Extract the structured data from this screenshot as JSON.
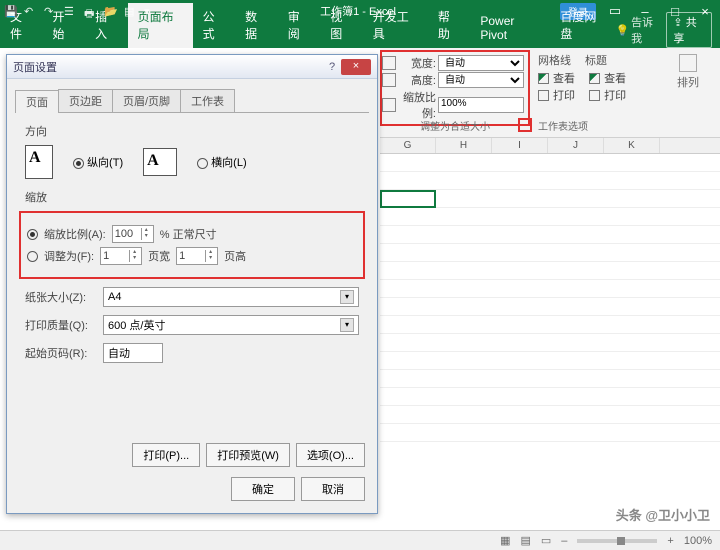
{
  "app": {
    "title": "工作簿1 - Excel",
    "login": "登录",
    "share": "共享",
    "tell": "告诉我"
  },
  "qat": [
    "save",
    "undo",
    "redo",
    "touch",
    "print",
    "open",
    "new",
    "more"
  ],
  "tabs": [
    "文件",
    "开始",
    "插入",
    "页面布局",
    "公式",
    "数据",
    "审阅",
    "视图",
    "开发工具",
    "帮助",
    "Power Pivot",
    "百度网盘"
  ],
  "activeTab": 3,
  "ribbon": {
    "scale": {
      "widthLabel": "宽度:",
      "widthVal": "自动",
      "heightLabel": "高度:",
      "heightVal": "自动",
      "scaleLabel": "缩放比例:",
      "scaleVal": "100%",
      "group": "调整为合适大小"
    },
    "opts": {
      "h1": "网格线",
      "h2": "标题",
      "view": "查看",
      "print": "打印",
      "group": "工作表选项"
    },
    "arrange": "排列"
  },
  "cols": [
    "G",
    "H",
    "I",
    "J",
    "K"
  ],
  "dialog": {
    "title": "页面设置",
    "tabs": [
      "页面",
      "页边距",
      "页眉/页脚",
      "工作表"
    ],
    "activeTab": 0,
    "orientation": {
      "title": "方向",
      "portrait": "纵向(T)",
      "landscape": "横向(L)",
      "selected": "portrait"
    },
    "zoom": {
      "title": "缩放",
      "scaleLabel": "缩放比例(A):",
      "scaleVal": "100",
      "scaleSuffix": "% 正常尺寸",
      "fitLabel": "调整为(F):",
      "fitW": "1",
      "fitWLabel": "页宽",
      "fitH": "1",
      "fitHLabel": "页高",
      "selected": "scale"
    },
    "paper": {
      "label": "纸张大小(Z):",
      "val": "A4"
    },
    "quality": {
      "label": "打印质量(Q):",
      "val": "600 点/英寸"
    },
    "firstPage": {
      "label": "起始页码(R):",
      "val": "自动"
    },
    "btns": {
      "print": "打印(P)...",
      "preview": "打印预览(W)",
      "options": "选项(O)...",
      "ok": "确定",
      "cancel": "取消"
    }
  },
  "status": {
    "zoom": "100%"
  },
  "watermark": "头条 @卫小小卫"
}
